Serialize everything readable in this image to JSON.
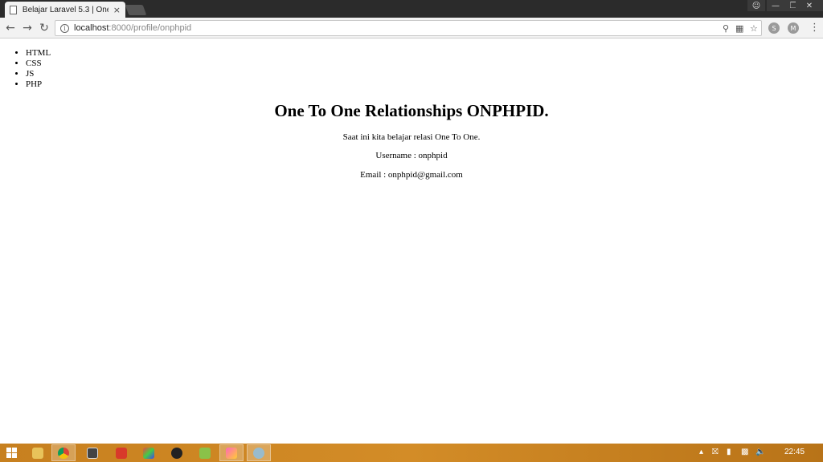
{
  "browser": {
    "tab_title": "Belajar Laravel 5.3 | One",
    "tab_close": "×",
    "url_host": "localhost",
    "url_rest": ":8000/profile/onphpid"
  },
  "page": {
    "menu": [
      "HTML",
      "CSS",
      "JS",
      "PHP"
    ],
    "title": "One To One Relationships ONPHPID.",
    "intro": "Saat ini kita belajar relasi One To One.",
    "username_line": "Username : onphpid",
    "email_line": "Email : onphpid@gmail.com"
  },
  "taskbar": {
    "clock": "22:45",
    "apps": [
      "file-explorer-icon",
      "chrome-icon",
      "terminal-icon",
      "app-red-icon",
      "app-color-icon",
      "app-dark-icon",
      "android-icon",
      "app-paint-icon",
      "app-blue-icon"
    ]
  }
}
